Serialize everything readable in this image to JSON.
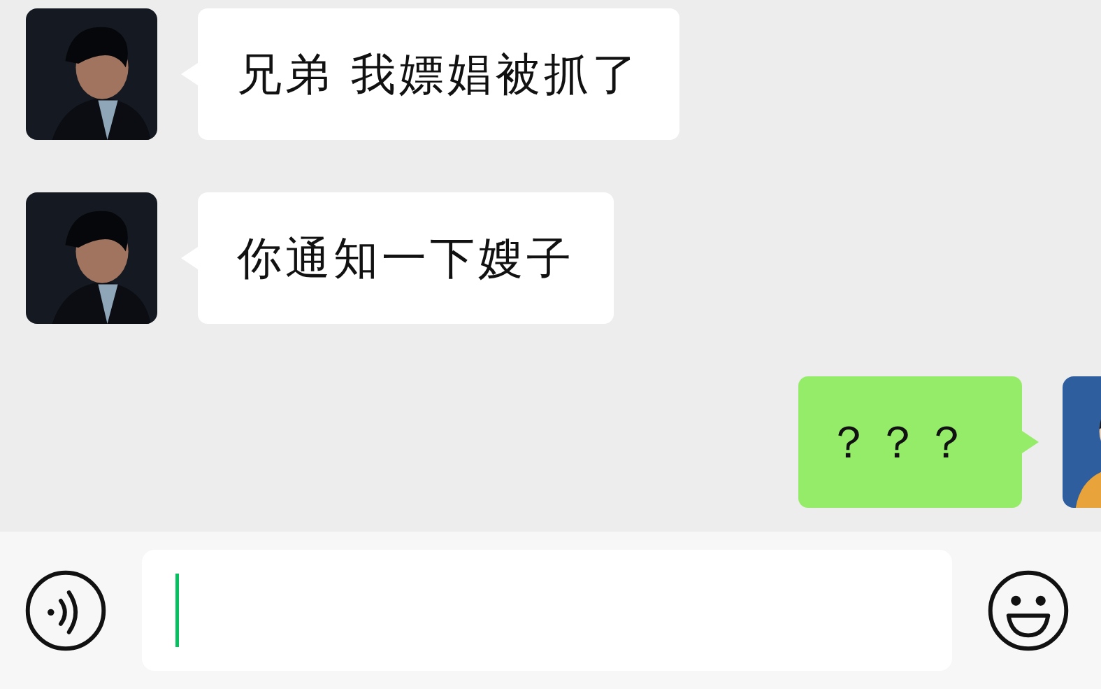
{
  "messages": [
    {
      "kind": "incoming",
      "text": "兄弟 我嫖娼被抓了"
    },
    {
      "kind": "incoming",
      "text": "你通知一下嫂子"
    },
    {
      "kind": "outgoing",
      "text": "？？？"
    }
  ],
  "composer": {
    "focused": true
  }
}
